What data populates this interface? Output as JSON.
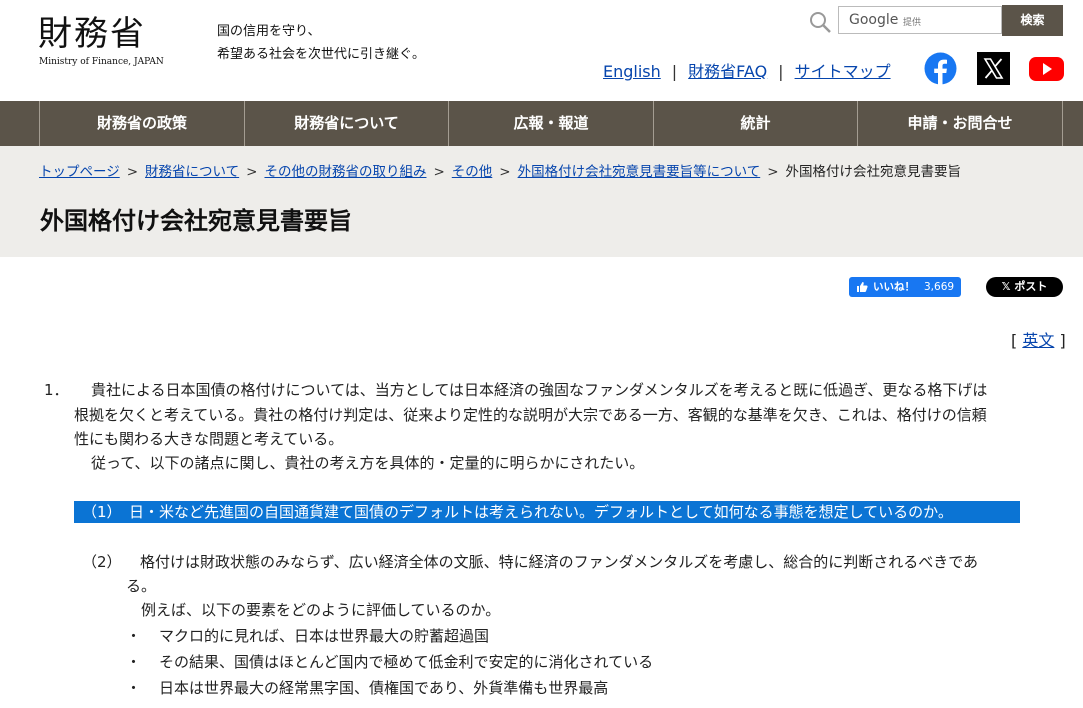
{
  "header": {
    "logo_kanji": "財務省",
    "logo_en": "Ministry of Finance, JAPAN",
    "tagline_line1": "国の信用を守り、",
    "tagline_line2": "希望ある社会を次世代に引き継ぐ。",
    "search": {
      "brand": "Google",
      "provided": "提供",
      "button": "検索"
    },
    "links": [
      "English",
      "財務省FAQ",
      "サイトマップ"
    ],
    "separator": "|",
    "social": [
      "facebook-icon",
      "x-icon",
      "youtube-icon"
    ]
  },
  "nav": [
    "財務省の政策",
    "財務省について",
    "広報・報道",
    "統計",
    "申請・お問合せ"
  ],
  "breadcrumb": {
    "links": [
      "トップページ",
      "財務省について",
      "その他の財務省の取り組み",
      "その他",
      "外国格付け会社宛意見書要旨等について"
    ],
    "arrow": ">",
    "current": "外国格付け会社宛意見書要旨"
  },
  "page_title": "外国格付け会社宛意見書要旨",
  "social_buttons": {
    "like_label": "いいね！",
    "like_count": "3,669",
    "post_label": "ポスト"
  },
  "english_link": {
    "open": "[",
    "label": "英文",
    "close": "]"
  },
  "content": {
    "p1_num": "1．",
    "p1_lines": [
      "貴社による日本国債の格付けについては、当方としては日本経済の強固なファンダメンタルズを考えると既に低過ぎ、更なる格下げは",
      "根拠を欠くと考えている。貴社の格付け判定は、従来より定性的な説明が大宗である一方、客観的な基準を欠き、これは、格付けの信頼",
      "性にも関わる大きな問題と考えている。",
      "従って、以下の諸点に関し、貴社の考え方を具体的・定量的に明らかにされたい。"
    ],
    "item1": "（1）　日・米など先進国の自国通貨建て国債のデフォルトは考えられない。デフォルトとして如何なる事態を想定しているのか。",
    "item2_num": "（2）",
    "item2_lines": [
      "格付けは財政状態のみならず、広い経済全体の文脈、特に経済のファンダメンタルズを考慮し、総合的に判断されるべきであ",
      "る。",
      "例えば、以下の要素をどのように評価しているのか。"
    ],
    "bullet": "・",
    "bullets": [
      "マクロ的に見れば、日本は世界最大の貯蓄超過国",
      "その結果、国債はほとんど国内で極めて低金利で安定的に消化されている",
      "日本は世界最大の経常黒字国、債権国であり、外貨準備も世界最高"
    ]
  }
}
